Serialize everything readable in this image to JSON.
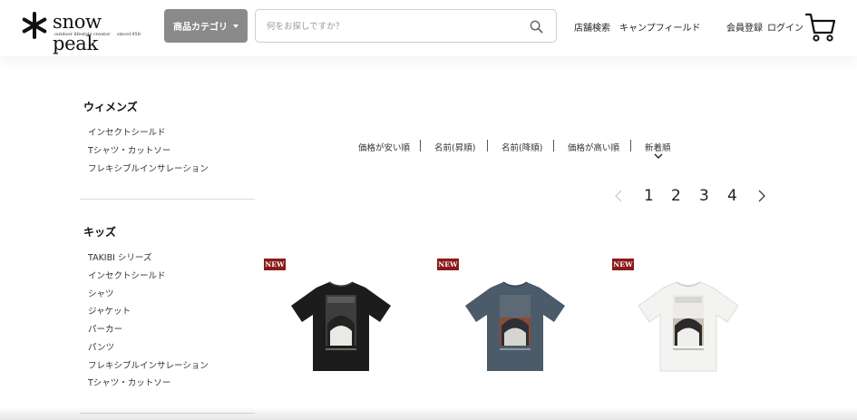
{
  "header": {
    "logo_text": "snow peak",
    "logo_tagline": "outdoor lifestyle creator",
    "logo_since": "since1958",
    "category_button": "商品カテゴリ",
    "search_placeholder": "何をお探しですか？",
    "links": {
      "store_search": "店舗検索",
      "campfield": "キャンプフィールド",
      "register": "会員登録",
      "login": "ログイン"
    }
  },
  "sidebar": {
    "women": {
      "title": "ウィメンズ",
      "items": [
        "インセクトシールド",
        "Tシャツ・カットソー",
        "フレキシブルインサレーション"
      ]
    },
    "kids": {
      "title": "キッズ",
      "items": [
        "TAKIBI シリーズ",
        "インセクトシールド",
        "シャツ",
        "ジャケット",
        "パーカー",
        "パンツ",
        "フレキシブルインサレーション",
        "Tシャツ・カットソー"
      ]
    }
  },
  "sort": {
    "options": [
      "価格が安い順",
      "名前(昇順)",
      "名前(降順)",
      "価格が高い順",
      "新着順"
    ],
    "selected": "新着順"
  },
  "pagination": {
    "pages": [
      "1",
      "2",
      "3",
      "4"
    ],
    "current": "1"
  },
  "products": [
    {
      "badge": "NEW",
      "color": "#1a1a1a"
    },
    {
      "badge": "NEW",
      "color": "#4b5a68"
    },
    {
      "badge": "NEW",
      "color": "#f4f4f2"
    }
  ],
  "colors": {
    "badge": "#8b1a1a",
    "category_button": "#8a8a8a"
  }
}
